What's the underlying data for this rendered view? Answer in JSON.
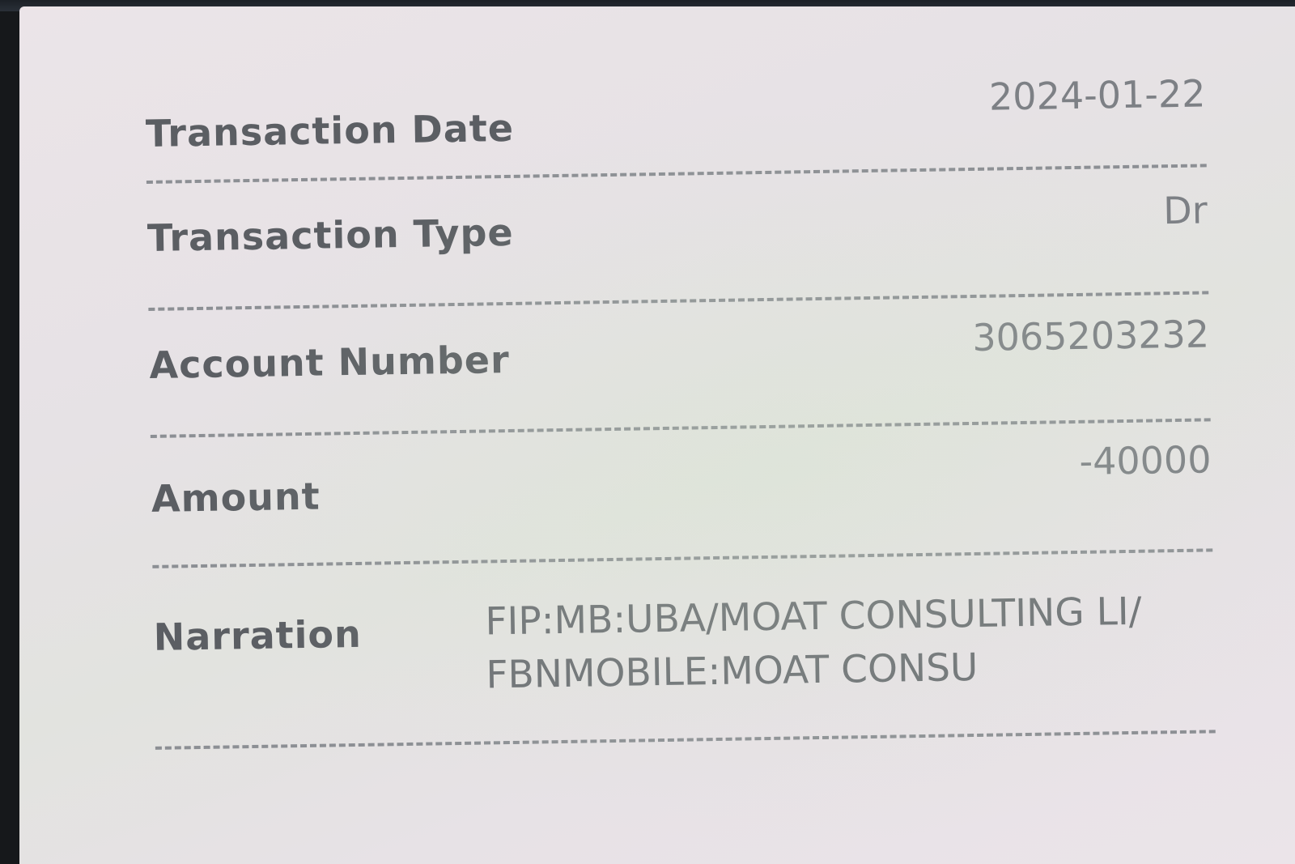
{
  "transaction_details": {
    "transaction_date": {
      "label": "Transaction Date",
      "value": "2024-01-22"
    },
    "transaction_type": {
      "label": "Transaction Type",
      "value": "Dr"
    },
    "account_number": {
      "label": "Account Number",
      "value": "3065203232"
    },
    "amount": {
      "label": "Amount",
      "value": "-40000"
    },
    "narration": {
      "label": "Narration",
      "lines": [
        "FIP:MB:UBA/MOAT CONSULTING LI/",
        "FBNMOBILE:MOAT CONSU"
      ]
    }
  }
}
